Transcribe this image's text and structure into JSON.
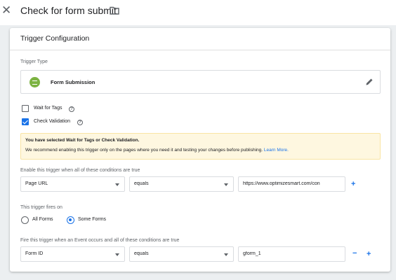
{
  "header": {
    "close_icon": "close-icon",
    "title": "Check for form submit",
    "folder_icon": "folder-icon"
  },
  "card": {
    "title": "Trigger Configuration",
    "trigger_type": {
      "label": "Trigger Type",
      "value": "Form Submission",
      "icon": "form-submission-icon",
      "edit_icon": "pencil-icon"
    },
    "options": [
      {
        "label": "Wait for Tags",
        "checked": false
      },
      {
        "label": "Check Validation",
        "checked": true
      }
    ],
    "warning": {
      "title": "You have selected Wait for Tags or Check Validation.",
      "body": "We recommend enabling this trigger only on the pages where you need it and testing your changes before publishing.",
      "link": "Learn More."
    },
    "enable_conditions": {
      "label": "Enable this trigger when all of these conditions are true",
      "variable": "Page URL",
      "operator": "equals",
      "value": "https://www.optimizesmart.com/con",
      "add": "+"
    },
    "fires_on": {
      "label": "This trigger fires on",
      "options": [
        "All Forms",
        "Some Forms"
      ],
      "selected": "Some Forms"
    },
    "fire_conditions": {
      "label": "Fire this trigger when an Event occurs and all of these conditions are true",
      "variable": "Form ID",
      "operator": "equals",
      "value": "gform_1",
      "remove": "−",
      "add": "+"
    }
  },
  "colors": {
    "accent": "#1a73e8",
    "trigger_icon": "#7cb342",
    "warning_bg": "#fef7e0"
  }
}
